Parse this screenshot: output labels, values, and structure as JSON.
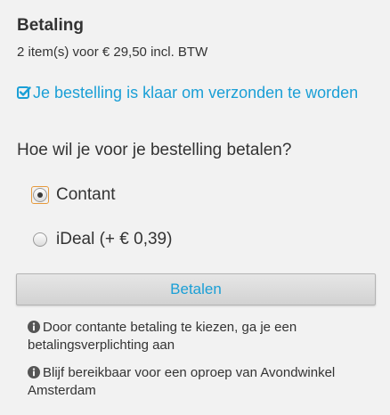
{
  "payment": {
    "title": "Betaling",
    "summary": "2 item(s) voor € 29,50 incl. BTW",
    "ready_message": "Je bestelling is klaar om verzonden te worden",
    "question": "Hoe wil je voor je bestelling betalen?",
    "options": [
      {
        "label": "Contant",
        "selected": true
      },
      {
        "label": "iDeal (+ € 0,39)",
        "selected": false
      }
    ],
    "pay_button_label": "Betalen",
    "info": [
      "Door contante betaling te kiezen, ga je een betalingsverplichting aan",
      "Blijf bereikbaar voor een oproep van Avondwinkel Amsterdam"
    ]
  },
  "icons": {
    "ready": "check-square-icon",
    "info": "info-circle-icon"
  },
  "colors": {
    "accent": "#1a9fd6",
    "text": "#333333",
    "background": "#f2f2f2",
    "focus_ring": "#e69a3c"
  }
}
